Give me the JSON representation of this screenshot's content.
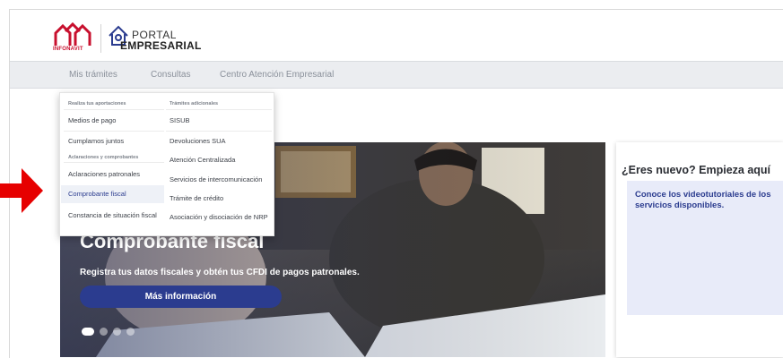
{
  "header": {
    "logo_text": "INFONAVIT",
    "portal_line1": "PORTAL",
    "portal_line2": "EMPRESARIAL"
  },
  "nav": {
    "items": [
      "Mis trámites",
      "Consultas",
      "Centro Atención Empresarial"
    ]
  },
  "dropdown": {
    "col1_header1": "Realiza tus aportaciones",
    "col1_items_a": [
      "Medios de pago",
      "Cumplamos juntos"
    ],
    "col1_header2": "Aclaraciones y comprobantes",
    "col1_items_b": [
      "Aclaraciones patronales",
      "Comprobante fiscal",
      "Constancia de situación fiscal"
    ],
    "col2_header": "Trámites adicionales",
    "col2_items": [
      "SISUB",
      "Devoluciones SUA",
      "Atención Centralizada",
      "Servicios de intercomunicación",
      "Trámite de crédito",
      "Asociación y disociación de NRP"
    ]
  },
  "banner": {
    "title": "Comprobante fiscal",
    "subtitle": "Registra tus datos fiscales y obtén tus CFDI de pagos patronales.",
    "button": "Más información",
    "active_slide": 1,
    "slide_count": 4
  },
  "card": {
    "title": "¿Eres nuevo? Empieza aquí",
    "text": "Conoce los videotutoriales de los servicios disponibles."
  },
  "colors": {
    "brand_red": "#c8102e",
    "brand_blue": "#2b3c8f",
    "arrow_red": "#e60000"
  }
}
